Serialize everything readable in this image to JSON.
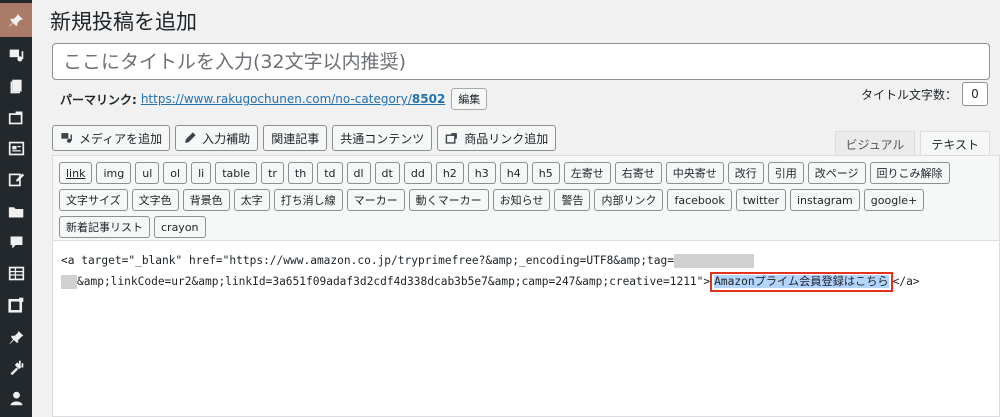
{
  "sidebar": {
    "icons": [
      "pin-icon",
      "media-icon",
      "pages-icon",
      "feedback-icon",
      "card-icon",
      "edit-icon",
      "folder-icon",
      "comments-icon",
      "table-icon",
      "plugin-icon",
      "pushpin-icon",
      "tools-icon",
      "users-icon"
    ]
  },
  "page": {
    "title": "新規投稿を追加"
  },
  "post_title": {
    "placeholder": "ここにタイトルを入力(32文字以内推奨)",
    "value": ""
  },
  "permalink": {
    "label": "パーマリンク:",
    "url_base": "https://www.rakugochunen.com/no-category/",
    "url_slug": "8502",
    "edit_button": "編集"
  },
  "title_count": {
    "label": "タイトル文字数：",
    "value": "0"
  },
  "media_buttons": {
    "add_media": "メディアを追加",
    "input_assist": "入力補助",
    "related_articles": "関連記事",
    "shared_content": "共通コンテンツ",
    "product_link": "商品リンク追加"
  },
  "editor_tabs": {
    "visual": "ビジュアル",
    "text": "テキスト"
  },
  "quicktags": [
    "link",
    "img",
    "ul",
    "ol",
    "li",
    "table",
    "tr",
    "th",
    "td",
    "dl",
    "dt",
    "dd",
    "h2",
    "h3",
    "h4",
    "h5",
    "左寄せ",
    "右寄せ",
    "中央寄せ",
    "改行",
    "引用",
    "改ページ",
    "回りこみ解除",
    "文字サイズ",
    "文字色",
    "背景色",
    "太字",
    "打ち消し線",
    "マーカー",
    "動くマーカー",
    "お知らせ",
    "警告",
    "内部リンク",
    "facebook",
    "twitter",
    "instagram",
    "google+",
    "新着記事リスト",
    "crayon"
  ],
  "code": {
    "line1": "<a target=\"_blank\" href=\"https://www.amazon.co.jp/tryprimefree?&amp;_encoding=UTF8&amp;tag=",
    "line2_rest": "&amp;linkCode=ur2&amp;linkId=3a651f09adaf3d2cdf4d338dcab3b5e7&amp;camp=247&amp;creative=1211\">",
    "highlighted": "Amazonプライム会員登録はこちら",
    "line2_tail": "</a>"
  },
  "colors": {
    "admin_bar": "#23282d",
    "active_menu": "#a97b68",
    "highlight_border": "#e2331e",
    "selection": "#b3d4fc",
    "link": "#2271b1"
  }
}
